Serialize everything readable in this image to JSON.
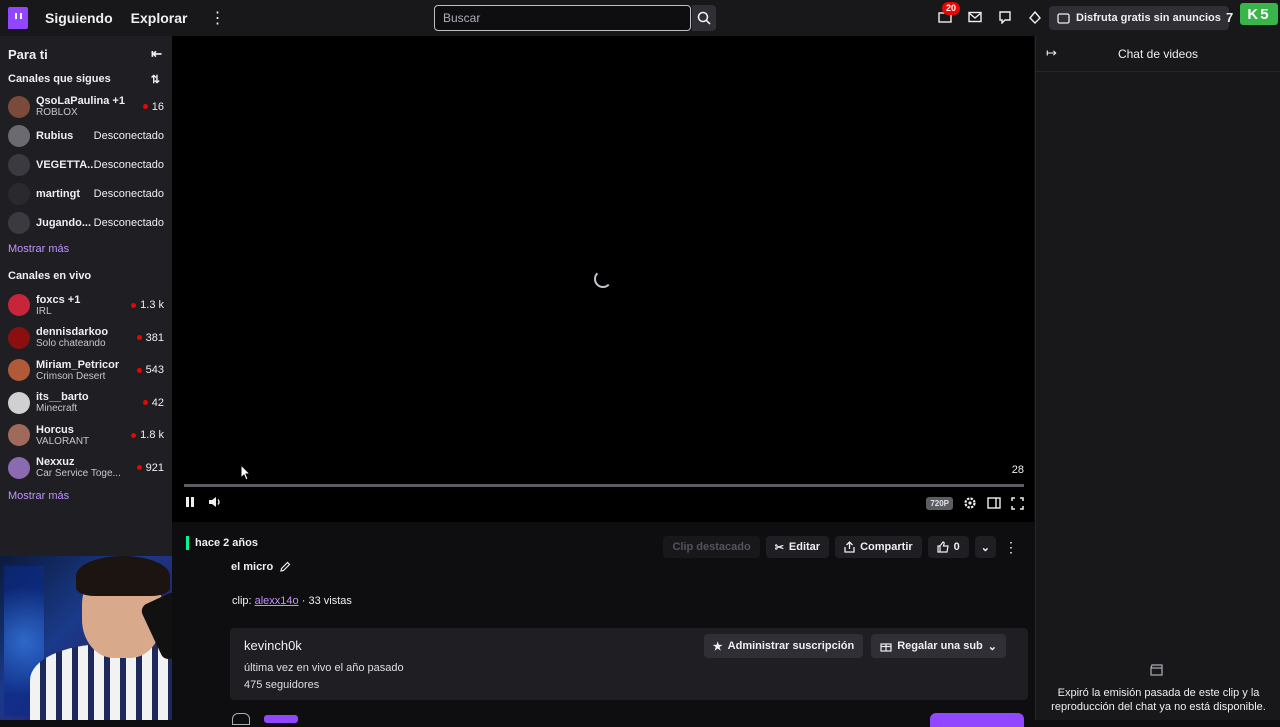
{
  "nav": {
    "following": "Siguiendo",
    "browse": "Explorar",
    "search_placeholder": "Buscar",
    "notif_count": "20",
    "promo_label": "Disfruta gratis sin anuncios",
    "brand_glyph": "K5"
  },
  "sidebar": {
    "title": "Para ti",
    "followed_title": "Canales que sigues",
    "followed": [
      {
        "name": "QsoLaPaulina +1",
        "game": "ROBLOX",
        "status": "16",
        "live": true,
        "color": "#7a4b3a"
      },
      {
        "name": "Rubius",
        "game": "",
        "status": "Desconectado",
        "live": false,
        "color": "#6a6a70"
      },
      {
        "name": "VEGETTA...",
        "game": "",
        "status": "Desconectado",
        "live": false,
        "color": "#3a3a40"
      },
      {
        "name": "martingt",
        "game": "",
        "status": "Desconectado",
        "live": false,
        "color": "#2a2a2e"
      },
      {
        "name": "Jugando...",
        "game": "",
        "status": "Desconectado",
        "live": false,
        "color": "#3a3a40"
      }
    ],
    "show_more": "Mostrar más",
    "live_title": "Canales en vivo",
    "live": [
      {
        "name": "foxcs +1",
        "game": "IRL",
        "viewers": "1.3 k",
        "color": "#c8243a"
      },
      {
        "name": "dennisdarkoo",
        "game": "Solo chateando",
        "viewers": "381",
        "color": "#8a1010"
      },
      {
        "name": "Miriam_Petricor",
        "game": "Crimson Desert",
        "viewers": "543",
        "color": "#b05a3a"
      },
      {
        "name": "its__barto",
        "game": "Minecraft",
        "viewers": "42",
        "color": "#d0d0d0"
      },
      {
        "name": "Horcus",
        "game": "VALORANT",
        "viewers": "1.8 k",
        "color": "#a06a5a"
      },
      {
        "name": "Nexxuz",
        "game": "Car Service Toge...",
        "viewers": "921",
        "color": "#8a6ab0"
      }
    ],
    "show_more_live": "Mostrar más"
  },
  "player": {
    "time": "28",
    "quality": "720P",
    "progress": 0.0
  },
  "clip": {
    "ago": "hace 2 años",
    "title": "el micro",
    "clip_prefix": "clip:",
    "clipper": "alexx14o",
    "views": "· 33 vistas",
    "featured": "Clip destacado",
    "edit": "Editar",
    "share": "Compartir",
    "likes": "0"
  },
  "channel": {
    "name": "kevinch0k",
    "last_live": "última vez en vivo el año pasado",
    "followers": "475 seguidores",
    "manage_sub": "Administrar suscripción",
    "gift_sub": "Regalar una sub"
  },
  "chat": {
    "title": "Chat de videos",
    "message": "Expiró la emisión pasada de este clip y la reproducción del chat ya no está disponible."
  }
}
